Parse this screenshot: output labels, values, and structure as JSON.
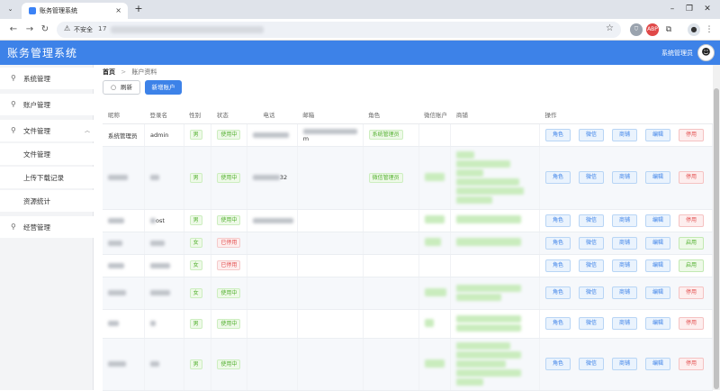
{
  "browser": {
    "tab_title": "账务管理系统",
    "security_label": "不安全",
    "url": "17"
  },
  "app": {
    "title": "账务管理系统",
    "user_name": "系统管理员"
  },
  "sidebar": {
    "items": [
      {
        "label": "系统管理",
        "icon": "location-pin-icon"
      },
      {
        "label": "账户管理",
        "icon": "location-pin-icon"
      },
      {
        "label": "文件管理",
        "icon": "location-pin-icon",
        "expanded": true
      },
      {
        "label": "文件管理",
        "sub": true
      },
      {
        "label": "上传下载记录",
        "sub": true
      },
      {
        "label": "资源统计",
        "sub": true
      },
      {
        "label": "经营管理",
        "icon": "location-pin-icon"
      }
    ]
  },
  "breadcrumb": {
    "home": "首页",
    "sep": ">",
    "current": "账户资料"
  },
  "toolbar": {
    "refresh_label": "刷新",
    "add_label": "新增账户"
  },
  "table": {
    "headers": [
      "昵称",
      "登录名",
      "性别",
      "状态",
      "电话",
      "邮箱",
      "角色",
      "微信账户",
      "商铺",
      "操作"
    ],
    "rows": [
      {
        "nickname": "系统管理员",
        "login": "admin",
        "gender": "男",
        "status": "使用中",
        "status_ok": true,
        "phone": "",
        "email": "m",
        "role": "系统管理员",
        "toggle": "停用"
      },
      {
        "nickname": "",
        "login": "",
        "gender": "男",
        "status": "使用中",
        "status_ok": true,
        "phone": "32",
        "email": "",
        "role": "微信管理员",
        "toggle": "停用"
      },
      {
        "nickname": "",
        "login": "ost",
        "gender": "男",
        "status": "使用中",
        "status_ok": true,
        "phone": "",
        "email": "",
        "role": "",
        "toggle": "停用"
      },
      {
        "nickname": "",
        "login": "",
        "gender": "女",
        "status": "已停用",
        "status_ok": false,
        "phone": "",
        "email": "",
        "role": "",
        "toggle": "启用"
      },
      {
        "nickname": "",
        "login": "",
        "gender": "女",
        "status": "已停用",
        "status_ok": false,
        "phone": "",
        "email": "",
        "role": "",
        "toggle": "启用"
      },
      {
        "nickname": "",
        "login": "",
        "gender": "女",
        "status": "使用中",
        "status_ok": true,
        "phone": "",
        "email": "",
        "role": "",
        "toggle": "停用"
      },
      {
        "nickname": "",
        "login": "",
        "gender": "男",
        "status": "使用中",
        "status_ok": true,
        "phone": "",
        "email": "",
        "role": "",
        "toggle": "停用"
      },
      {
        "nickname": "",
        "login": "",
        "gender": "男",
        "status": "使用中",
        "status_ok": true,
        "phone": "",
        "email": "",
        "role": "",
        "toggle": "停用"
      }
    ],
    "actions": [
      "角色",
      "微信",
      "商铺",
      "编辑"
    ]
  },
  "colors": {
    "header_bg": "#3d82e8",
    "tag_green": "#52b02f",
    "tag_red": "#e35050",
    "action_blue": "#3d82e8"
  }
}
